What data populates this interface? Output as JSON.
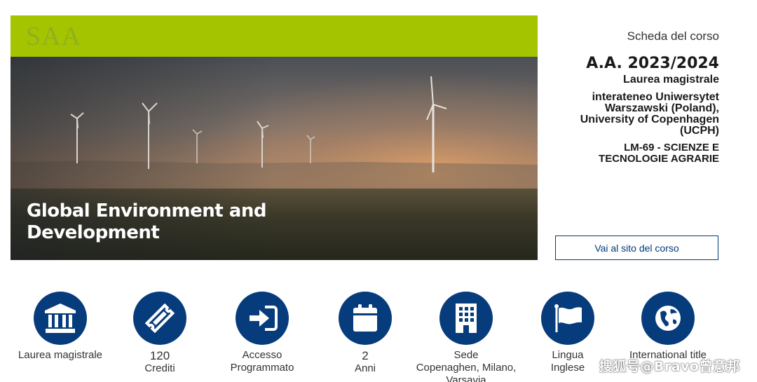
{
  "brand": {
    "logo": "SAA",
    "band_color": "#a4c400"
  },
  "hero": {
    "title": "Global Environment and Development"
  },
  "panel": {
    "label": "Scheda del corso",
    "year": "A.A. 2023/2024",
    "degree": "Laurea magistrale",
    "university": "interateneo Uniwersytet Warszawski (Poland), University of Copenhagen (UCPH)",
    "class": "LM-69 - SCIENZE E TECNOLOGIE AGRARIE",
    "button": "Vai al sito del corso"
  },
  "features": [
    {
      "icon": "university-icon",
      "line1": "Laurea magistrale"
    },
    {
      "icon": "ticket-icon",
      "value": "120",
      "line1": "Crediti"
    },
    {
      "icon": "sign-in-icon",
      "line1": "Accesso",
      "line2": "Programmato"
    },
    {
      "icon": "calendar-icon",
      "value": "2",
      "line1": "Anni"
    },
    {
      "icon": "building-icon",
      "line1": "Sede",
      "line2": "Copenaghen, Milano,",
      "line3": "Varsavia"
    },
    {
      "icon": "flag-icon",
      "line1": "Lingua",
      "line2": "Inglese"
    },
    {
      "icon": "globe-icon",
      "line1": "International title"
    }
  ],
  "colors": {
    "accent": "#073c7c",
    "button_border": "#003b7a"
  },
  "watermark": "搜狐号@Bravo曾意邦"
}
